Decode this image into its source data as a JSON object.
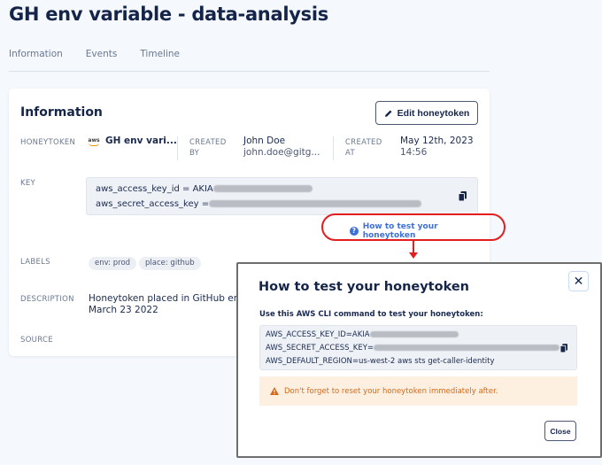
{
  "page": {
    "title": "GH env variable - data-analysis"
  },
  "tabs": [
    {
      "label": "Information"
    },
    {
      "label": "Events"
    },
    {
      "label": "Timeline"
    }
  ],
  "card": {
    "title": "Information",
    "edit_button": {
      "label": "Edit honeytoken",
      "icon": "pencil-icon"
    },
    "honeytoken": {
      "label": "HONEYTOKEN",
      "logo": "aws",
      "value": "GH env vari..."
    },
    "created_by": {
      "label_line1": "CREATED",
      "label_line2": "BY",
      "name": "John Doe",
      "email": "john.doe@gitg..."
    },
    "created_at": {
      "label_line1": "CREATED",
      "label_line2": "AT",
      "date": "May 12th, 2023",
      "time": "14:56"
    },
    "key": {
      "label": "KEY",
      "access_key_prefix": "aws_access_key_id = AKIA",
      "secret_key_prefix": "aws_secret_access_key =",
      "copy_icon": "copy-icon"
    },
    "how_to_link": {
      "label": "How to test your honeytoken",
      "icon": "question-circle-icon"
    },
    "labels": {
      "label": "LABELS",
      "chips": [
        "env: prod",
        "place: github"
      ]
    },
    "description": {
      "label": "DESCRIPTION",
      "line1": "Honeytoken placed in GitHub envi",
      "line2": "March 23 2022"
    },
    "source": {
      "label": "SOURCE"
    }
  },
  "annotation": {
    "highlight_color": "#e41e1e"
  },
  "modal": {
    "title": "How to test your honeytoken",
    "close_icon": "close-icon",
    "subtitle": "Use this AWS CLI command to test your honeytoken:",
    "cli": {
      "line1_prefix": "AWS_ACCESS_KEY_ID=AKIA",
      "line2_prefix": "AWS_SECRET_ACCESS_KEY=",
      "line3": "AWS_DEFAULT_REGION=us-west-2 aws sts get-caller-identity"
    },
    "warning": {
      "icon": "warning-triangle-icon",
      "text": "Don't forget to reset your honeytoken immediately after."
    },
    "close_button": {
      "label": "Close"
    }
  }
}
